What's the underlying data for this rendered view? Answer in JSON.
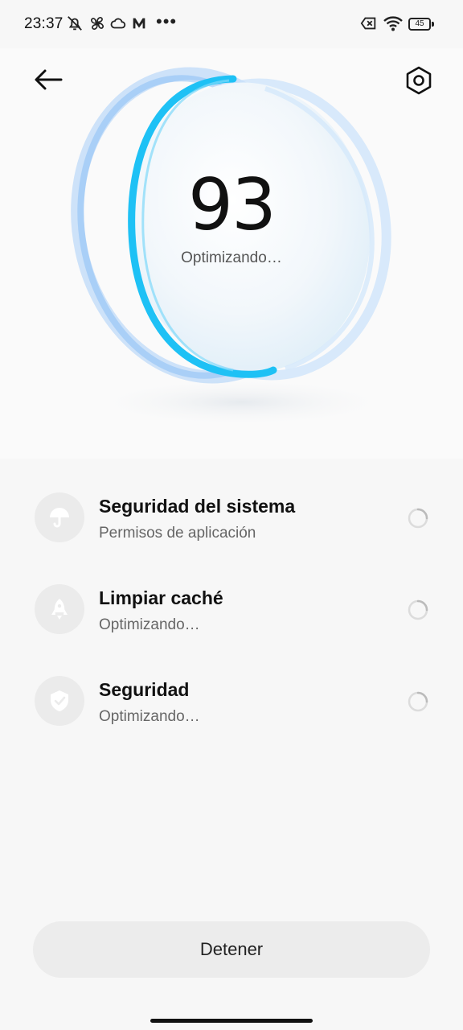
{
  "status_bar": {
    "time": "23:37",
    "icons": [
      "notifications-off-icon",
      "fan-icon",
      "cloud-icon",
      "m-app-icon",
      "more-dots-icon",
      "sim-error-icon",
      "wifi-icon",
      "battery-icon"
    ],
    "more": "•••",
    "battery_level": "45"
  },
  "header": {
    "back_icon": "arrow-left-icon",
    "settings_icon": "settings-hexagon-icon"
  },
  "hero": {
    "score": "93",
    "status": "Optimizando…",
    "accent_color": "#1ec1f5"
  },
  "tasks": [
    {
      "icon": "umbrella-icon",
      "title": "Seguridad del sistema",
      "subtitle": "Permisos de aplicación"
    },
    {
      "icon": "rocket-icon",
      "title": "Limpiar caché",
      "subtitle": "Optimizando…"
    },
    {
      "icon": "shield-check-icon",
      "title": "Seguridad",
      "subtitle": "Optimizando…"
    }
  ],
  "footer": {
    "stop_label": "Detener"
  }
}
